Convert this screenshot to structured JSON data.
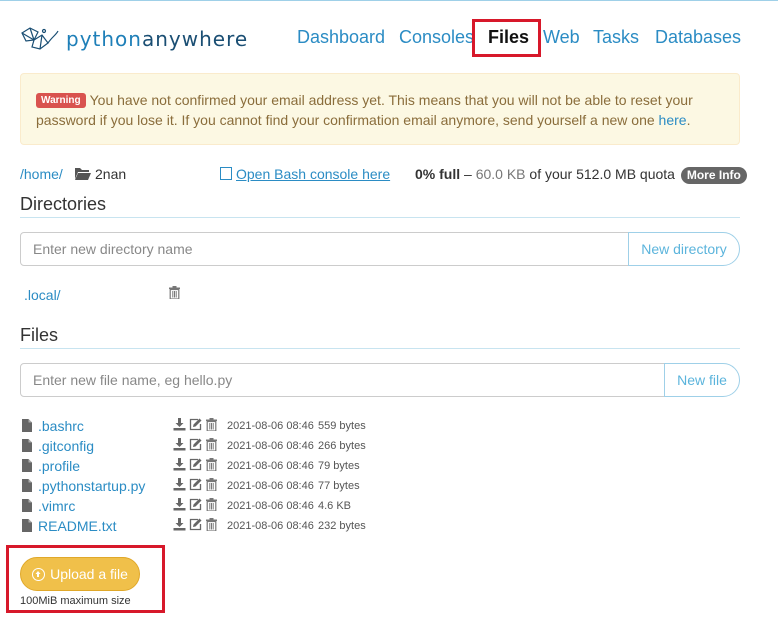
{
  "header": {
    "logo_text_a": "python",
    "logo_text_b": "anywhere",
    "nav": [
      "Dashboard",
      "Consoles",
      "Files",
      "Web",
      "Tasks",
      "Databases"
    ]
  },
  "warning": {
    "badge": "Warning",
    "message": "You have not confirmed your email address yet. This means that you will not be able to reset your password if you lose it. If you cannot find your confirmation email anymore, send yourself a new one",
    "link": "here",
    "end": "."
  },
  "pathbar": {
    "crumb": "/home/",
    "current": "2nan",
    "bash_link": "Open Bash console here",
    "quota_pct": "0% full",
    "quota_sep": " – ",
    "quota_used": "60.0 KB",
    "quota_rest": " of your 512.0 MB quota",
    "more_info": "More Info"
  },
  "directories": {
    "title": "Directories",
    "placeholder": "Enter new directory name",
    "button": "New directory",
    "items": [
      ".local/"
    ]
  },
  "files": {
    "title": "Files",
    "placeholder": "Enter new file name, eg hello.py",
    "button": "New file",
    "items": [
      {
        "name": ".bashrc",
        "date": "2021-08-06 08:46",
        "size": "559 bytes"
      },
      {
        "name": ".gitconfig",
        "date": "2021-08-06 08:46",
        "size": "266 bytes"
      },
      {
        "name": ".profile",
        "date": "2021-08-06 08:46",
        "size": "79 bytes"
      },
      {
        "name": ".pythonstartup.py",
        "date": "2021-08-06 08:46",
        "size": "77 bytes"
      },
      {
        "name": ".vimrc",
        "date": "2021-08-06 08:46",
        "size": "4.6 KB"
      },
      {
        "name": "README.txt",
        "date": "2021-08-06 08:46",
        "size": "232 bytes"
      }
    ]
  },
  "upload": {
    "button": "Upload a file",
    "note": "100MiB maximum size"
  },
  "colors": {
    "link": "#2b8cc4",
    "highlight": "#d7182a",
    "upload": "#f0c04a"
  }
}
